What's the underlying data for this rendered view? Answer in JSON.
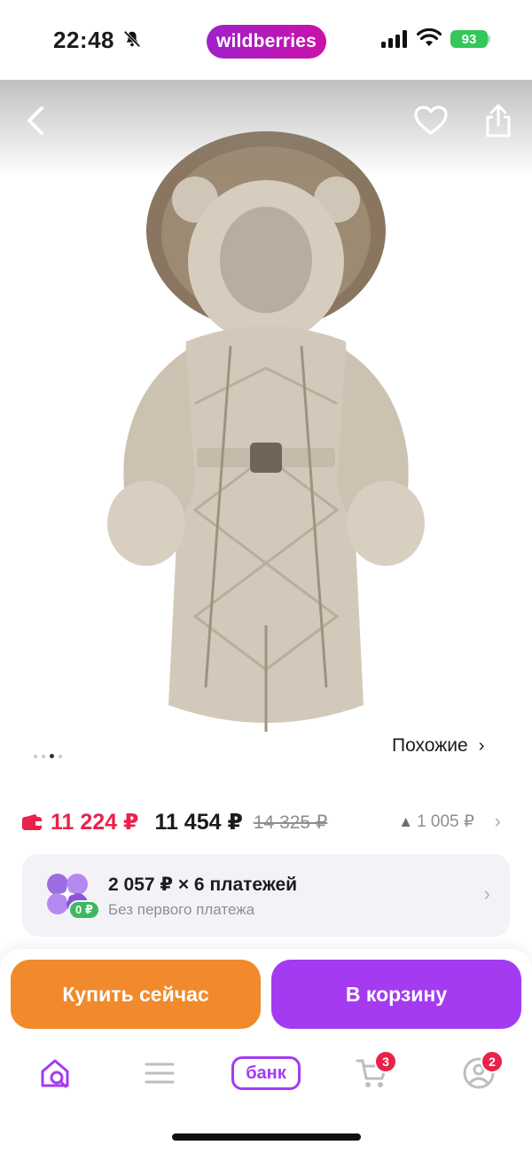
{
  "status_bar": {
    "time": "22:48",
    "app_logo": "wildberries",
    "battery": "93"
  },
  "gallery": {
    "image_alt": "Детский пуховый комбинезон бежевый с меховым капюшоном",
    "similar_label": "Похожие",
    "slides_total": 4,
    "slide_active": 3
  },
  "price": {
    "wallet_price": "11 224 ₽",
    "price": "11 454 ₽",
    "old_price": "14 325 ₽",
    "change": "1 005 ₽"
  },
  "installment": {
    "title": "2 057 ₽ × 6 платежей",
    "subtitle": "Без первого платежа",
    "badge": "0 ₽"
  },
  "actions": {
    "buy_now": "Купить сейчас",
    "add_to_cart": "В корзину"
  },
  "tabbar": {
    "bank_label": "банк",
    "cart_badge": "3",
    "profile_badge": "2"
  },
  "colors": {
    "brand": "#cb11ab",
    "buy_button": "#f08a2c",
    "cart_button": "#a43bf0",
    "wallet_price": "#e8234a",
    "badge": "#e8234a"
  },
  "icons": [
    "bell-slash-icon",
    "signal-icon",
    "wifi-icon",
    "back-icon",
    "heart-icon",
    "share-icon",
    "wallet-icon",
    "installment-icon",
    "home-search-icon",
    "catalog-icon",
    "cart-icon",
    "profile-icon"
  ]
}
